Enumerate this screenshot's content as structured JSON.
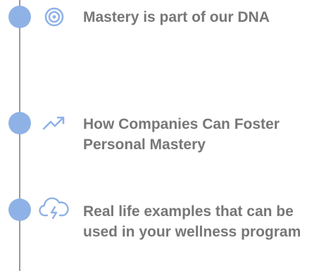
{
  "timeline": {
    "accent_color": "#8fb2e6",
    "line_color": "#9a9a9a",
    "text_color": "#777777",
    "items": [
      {
        "icon": "target-icon",
        "label": "Mastery is part of our DNA"
      },
      {
        "icon": "trending-up-icon",
        "label": "How Companies Can Foster Personal Mastery"
      },
      {
        "icon": "cloud-lightning-icon",
        "label": "Real life examples that can be used in your wellness program"
      }
    ]
  }
}
